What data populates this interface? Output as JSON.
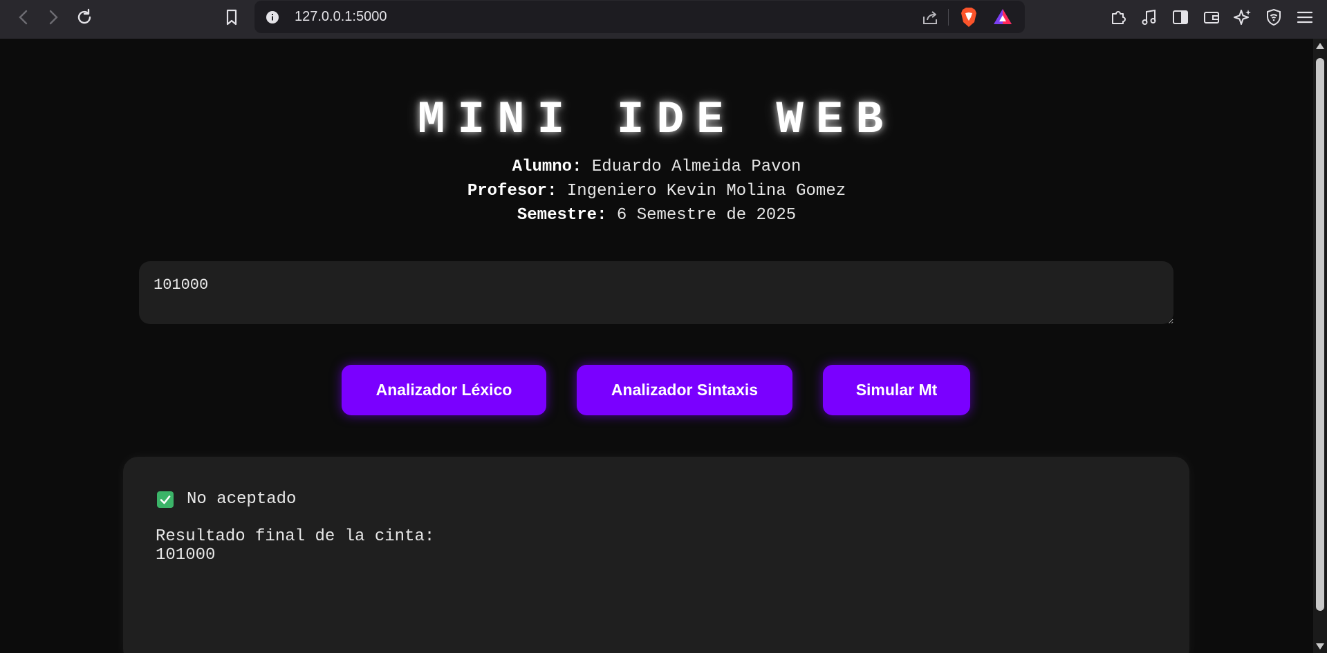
{
  "browser": {
    "url": "127.0.0.1:5000"
  },
  "header": {
    "title": "MINI IDE WEB",
    "alumno_label": "Alumno:",
    "alumno_value": "Eduardo Almeida Pavon",
    "profesor_label": "Profesor:",
    "profesor_value": "Ingeniero Kevin Molina Gomez",
    "semestre_label": "Semestre:",
    "semestre_value": "6 Semestre de 2025"
  },
  "editor": {
    "value": "101000"
  },
  "buttons": {
    "lexico": "Analizador Léxico",
    "sintaxis": "Analizador Sintaxis",
    "simular": "Simular Mt"
  },
  "output": {
    "status": "No aceptado",
    "result_label": "Resultado final de la cinta:",
    "result_value": "101000"
  },
  "colors": {
    "accent": "#7a00ff",
    "background": "#0c0c0c",
    "panel": "#1f1f1f",
    "check": "#3bb468"
  }
}
